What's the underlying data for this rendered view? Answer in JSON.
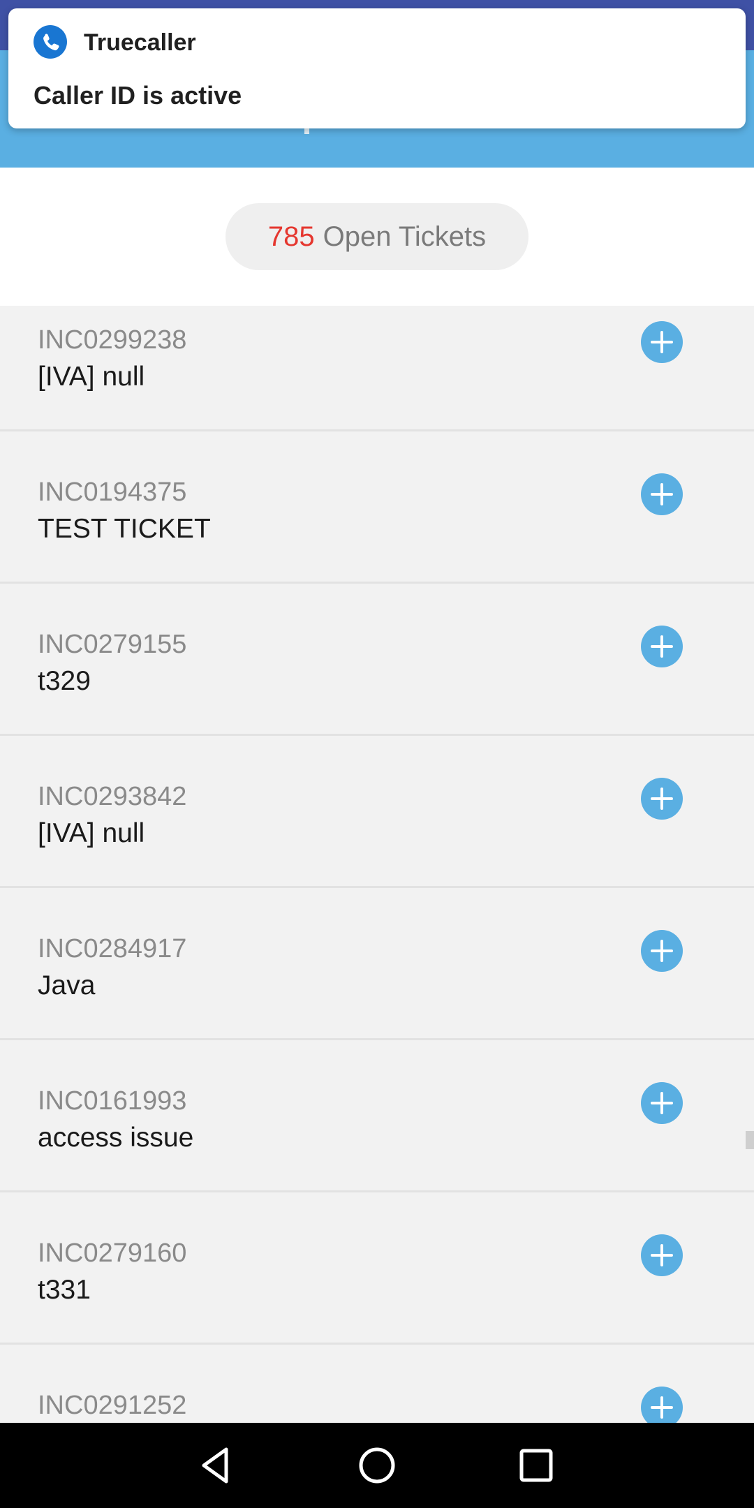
{
  "notification": {
    "app_name": "Truecaller",
    "message": "Caller ID is active",
    "icon": "phone-icon",
    "icon_color": "#1976d2"
  },
  "header": {
    "color": "#5aafe2"
  },
  "counter": {
    "count": "785",
    "label": "Open Tickets",
    "count_color": "#e5372f"
  },
  "tickets": [
    {
      "id": "INC0299238",
      "desc": "[IVA] null"
    },
    {
      "id": "INC0194375",
      "desc": "TEST TICKET"
    },
    {
      "id": "INC0279155",
      "desc": "t329"
    },
    {
      "id": "INC0293842",
      "desc": "[IVA] null"
    },
    {
      "id": "INC0284917",
      "desc": "Java"
    },
    {
      "id": "INC0161993",
      "desc": "access issue"
    },
    {
      "id": "INC0279160",
      "desc": "t331"
    },
    {
      "id": "INC0291252",
      "desc": ""
    }
  ],
  "ticket_action_icon": "plus-circle-icon",
  "nav": {
    "back_icon": "back-triangle-icon",
    "home_icon": "home-circle-icon",
    "recents_icon": "recents-square-icon"
  }
}
